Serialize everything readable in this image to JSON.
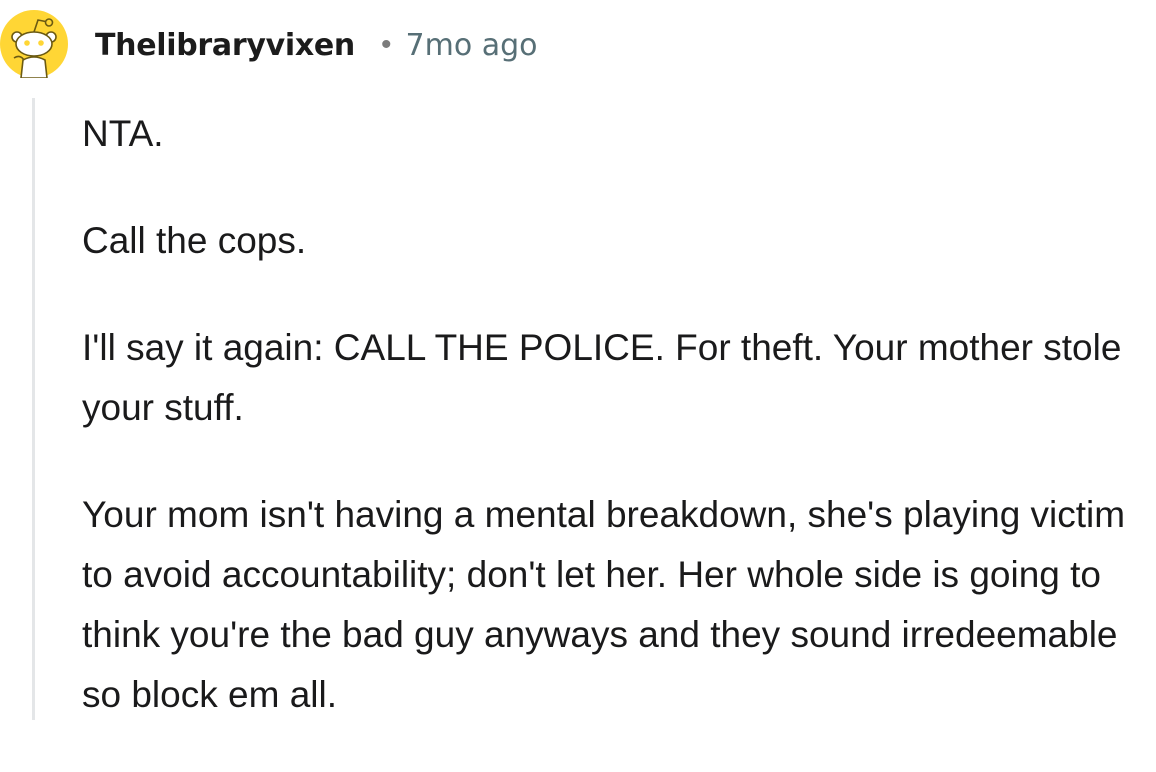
{
  "comment": {
    "author": "Thelibraryvixen",
    "separator": "•",
    "time": "7mo ago",
    "avatar_icon": "snoo-avatar-icon",
    "colors": {
      "avatar_bg": "#FFD635",
      "thread_line": "#E4E6E8",
      "time_text": "#576F76"
    },
    "paragraphs": [
      "NTA.",
      "Call the cops.",
      "I'll say it again: CALL THE POLICE. For theft. Your mother stole your stuff.",
      "Your mom isn't having a mental breakdown, she's playing victim to avoid accountability; don't let her. Her whole side is going to think you're the bad guy anyways and they sound irredeemable so block em all."
    ]
  }
}
